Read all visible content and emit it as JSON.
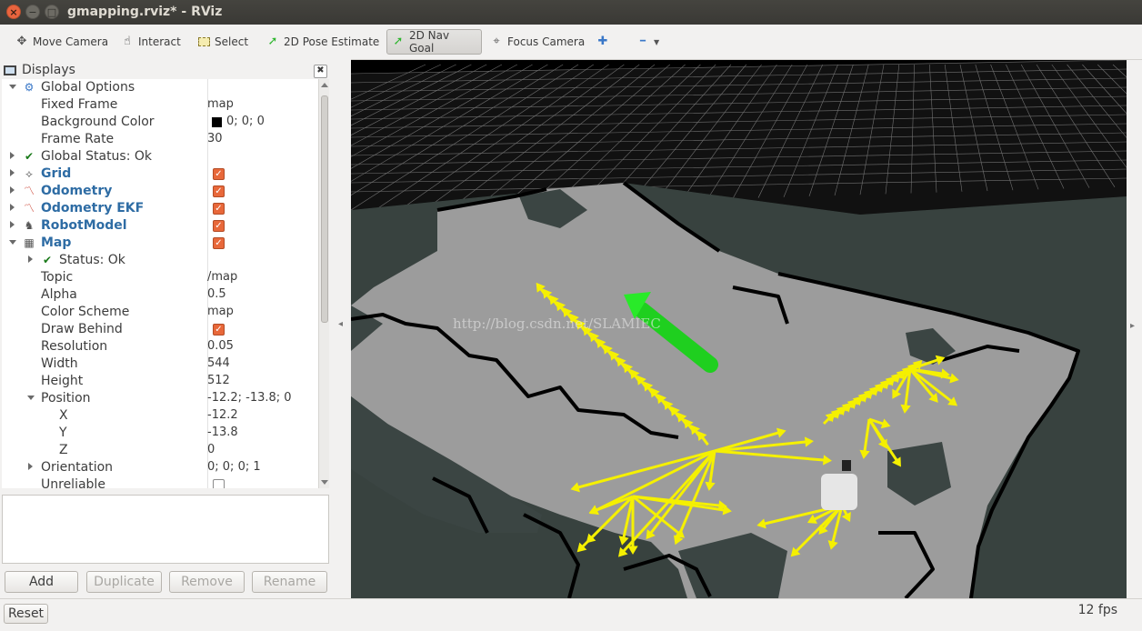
{
  "window": {
    "title": "gmapping.rviz* - RViz"
  },
  "toolbar": {
    "tools": [
      {
        "label": "Move Camera",
        "icon": "move-camera-icon",
        "glyph": "✥",
        "active": false
      },
      {
        "label": "Interact",
        "icon": "hand-icon",
        "glyph": "☝",
        "active": false
      },
      {
        "label": "Select",
        "icon": "select-icon",
        "glyph": "▭",
        "active": false
      },
      {
        "label": "2D Pose Estimate",
        "icon": "pose-estimate-icon",
        "glyph": "➚",
        "active": false
      },
      {
        "label": "2D Nav Goal",
        "icon": "nav-goal-icon",
        "glyph": "➚",
        "active": true
      },
      {
        "label": "Focus Camera",
        "icon": "focus-camera-icon",
        "glyph": "⌖",
        "active": false
      }
    ],
    "add_glyph": "✚",
    "remove_glyph": "━"
  },
  "displays": {
    "title": "Displays",
    "close_glyph": "✖",
    "rows": [
      {
        "name": "Global Options",
        "depth": 0,
        "expander": "down",
        "icon": "gear-icon",
        "glyph": "⚙",
        "value": "",
        "check": null,
        "style": "normal"
      },
      {
        "name": "Fixed Frame",
        "depth": 1,
        "expander": "",
        "icon": "",
        "glyph": "",
        "value": "map",
        "check": null,
        "style": "normal"
      },
      {
        "name": "Background Color",
        "depth": 1,
        "expander": "",
        "icon": "",
        "glyph": "",
        "value": "0; 0; 0",
        "swatch": "#000000",
        "check": null,
        "style": "normal"
      },
      {
        "name": "Frame Rate",
        "depth": 1,
        "expander": "",
        "icon": "",
        "glyph": "",
        "value": "30",
        "check": null,
        "style": "normal"
      },
      {
        "name": "Global Status: Ok",
        "depth": 0,
        "expander": "right",
        "icon": "check-icon",
        "glyph": "✔",
        "value": "",
        "check": null,
        "style": "normal"
      },
      {
        "name": "Grid",
        "depth": 0,
        "expander": "right",
        "icon": "grid-icon",
        "glyph": "⟡",
        "value": "",
        "check": true,
        "style": "bold"
      },
      {
        "name": "Odometry",
        "depth": 0,
        "expander": "right",
        "icon": "odometry-icon",
        "glyph": "〽",
        "value": "",
        "check": true,
        "style": "bold"
      },
      {
        "name": "Odometry EKF",
        "depth": 0,
        "expander": "right",
        "icon": "odometry-icon",
        "glyph": "〽",
        "value": "",
        "check": true,
        "style": "bold"
      },
      {
        "name": "RobotModel",
        "depth": 0,
        "expander": "right",
        "icon": "robot-icon",
        "glyph": "♞",
        "value": "",
        "check": true,
        "style": "bold"
      },
      {
        "name": "Map",
        "depth": 0,
        "expander": "down",
        "icon": "map-icon",
        "glyph": "▦",
        "value": "",
        "check": true,
        "style": "bold"
      },
      {
        "name": "Status: Ok",
        "depth": 1,
        "expander": "right",
        "icon": "check-icon",
        "glyph": "✔",
        "value": "",
        "check": null,
        "style": "normal"
      },
      {
        "name": "Topic",
        "depth": 1,
        "expander": "",
        "icon": "",
        "glyph": "",
        "value": "/map",
        "check": null,
        "style": "normal"
      },
      {
        "name": "Alpha",
        "depth": 1,
        "expander": "",
        "icon": "",
        "glyph": "",
        "value": "0.5",
        "check": null,
        "style": "normal"
      },
      {
        "name": "Color Scheme",
        "depth": 1,
        "expander": "",
        "icon": "",
        "glyph": "",
        "value": "map",
        "check": null,
        "style": "normal"
      },
      {
        "name": "Draw Behind",
        "depth": 1,
        "expander": "",
        "icon": "",
        "glyph": "",
        "value": "",
        "check": true,
        "style": "normal"
      },
      {
        "name": "Resolution",
        "depth": 1,
        "expander": "",
        "icon": "",
        "glyph": "",
        "value": "0.05",
        "check": null,
        "style": "normal"
      },
      {
        "name": "Width",
        "depth": 1,
        "expander": "",
        "icon": "",
        "glyph": "",
        "value": "544",
        "check": null,
        "style": "normal"
      },
      {
        "name": "Height",
        "depth": 1,
        "expander": "",
        "icon": "",
        "glyph": "",
        "value": "512",
        "check": null,
        "style": "normal"
      },
      {
        "name": "Position",
        "depth": 1,
        "expander": "down",
        "icon": "",
        "glyph": "",
        "value": "-12.2; -13.8; 0",
        "check": null,
        "style": "normal"
      },
      {
        "name": "X",
        "depth": 2,
        "expander": "",
        "icon": "",
        "glyph": "",
        "value": "-12.2",
        "check": null,
        "style": "normal"
      },
      {
        "name": "Y",
        "depth": 2,
        "expander": "",
        "icon": "",
        "glyph": "",
        "value": "-13.8",
        "check": null,
        "style": "normal"
      },
      {
        "name": "Z",
        "depth": 2,
        "expander": "",
        "icon": "",
        "glyph": "",
        "value": "0",
        "check": null,
        "style": "normal"
      },
      {
        "name": "Orientation",
        "depth": 1,
        "expander": "right",
        "icon": "",
        "glyph": "",
        "value": "0; 0; 0; 1",
        "check": null,
        "style": "normal"
      },
      {
        "name": "Unreliable",
        "depth": 1,
        "expander": "",
        "icon": "",
        "glyph": "",
        "value": "",
        "check": false,
        "style": "normal"
      }
    ],
    "buttons": {
      "add": "Add",
      "duplicate": "Duplicate",
      "remove": "Remove",
      "rename": "Rename"
    }
  },
  "viewport": {
    "watermark": "http://blog.csdn.net/SLAMIEC",
    "colors": {
      "floor": "#3a4443",
      "free": "#9a9a9a",
      "occupied": "#000000",
      "unknown": "#8a8a8a",
      "odometry": "#f5f000",
      "goal": "#22ee22",
      "grid": "#a8a8a8"
    }
  },
  "status": {
    "reset": "Reset",
    "fps": "12 fps"
  },
  "splitter": {
    "left_glyph": "◂",
    "right_glyph": "▸"
  }
}
